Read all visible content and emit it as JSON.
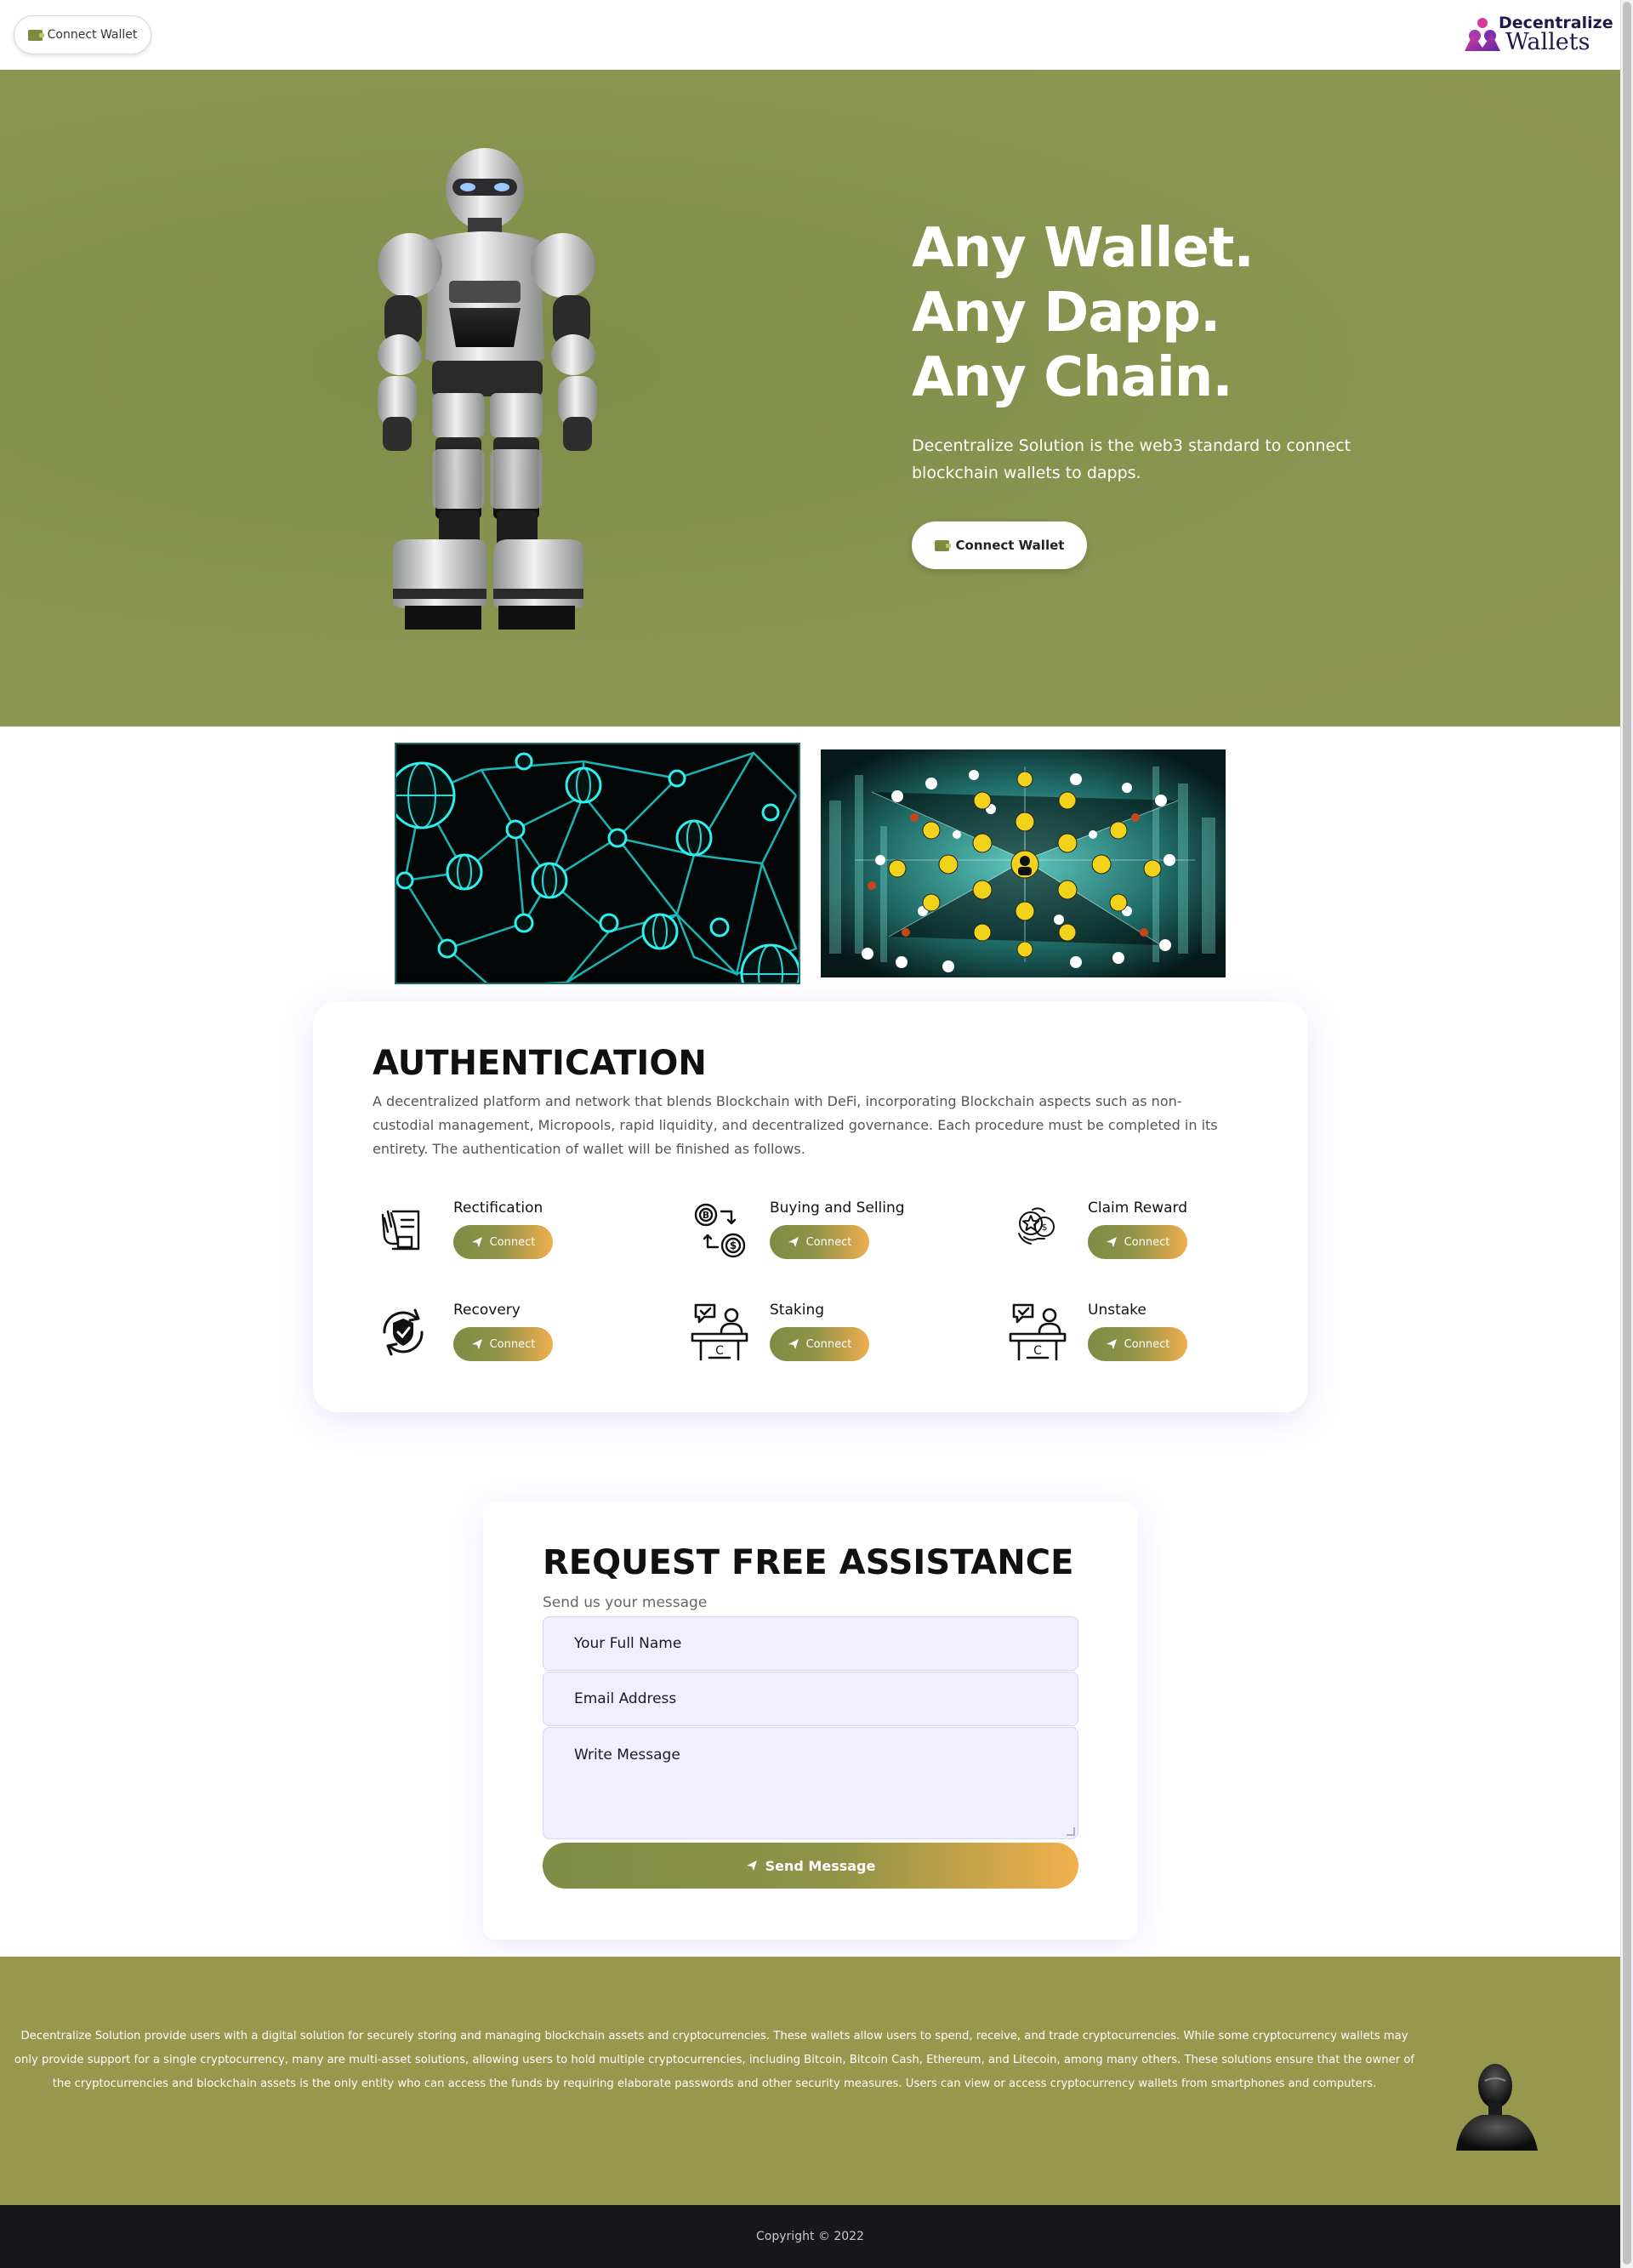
{
  "header": {
    "connect_wallet_label": "Connect Wallet",
    "logo_line1": "Decentralize",
    "logo_line2": "Wallets"
  },
  "hero": {
    "title_line1": "Any Wallet.",
    "title_line2": "Any Dapp.",
    "title_line3": "Any Chain.",
    "description": "Decentralize Solution is the web3 standard to connect blockchain wallets to dapps.",
    "button_label": "Connect Wallet"
  },
  "authentication": {
    "title": "AUTHENTICATION",
    "description": "A decentralized platform and network that blends Blockchain with DeFi, incorporating Blockchain aspects such as non-custodial management, Micropools, rapid liquidity, and decentralized governance. Each procedure must be completed in its entirety. The authentication of wallet will be finished as follows.",
    "features": [
      {
        "label": "Rectification",
        "button": "Connect",
        "icon": "document-hand-icon"
      },
      {
        "label": "Buying and Selling",
        "button": "Connect",
        "icon": "crypto-exchange-icon"
      },
      {
        "label": "Claim Reward",
        "button": "Connect",
        "icon": "reward-coins-icon"
      },
      {
        "label": "Recovery",
        "button": "Connect",
        "icon": "shield-recovery-icon"
      },
      {
        "label": "Staking",
        "button": "Connect",
        "icon": "staking-desk-icon"
      },
      {
        "label": "Unstake",
        "button": "Connect",
        "icon": "unstake-desk-icon"
      }
    ]
  },
  "assistance": {
    "title": "REQUEST FREE ASSISTANCE",
    "subtitle": "Send us your message",
    "name_placeholder": "Your Full Name",
    "email_placeholder": "Email Address",
    "message_placeholder": "Write Message",
    "send_label": "Send Message"
  },
  "footer": {
    "text": "Decentralize Solution provide users with a digital solution for securely storing and managing blockchain assets and cryptocurrencies. These wallets allow users to spend, receive, and trade cryptocurrencies. While some cryptocurrency wallets may only provide support for a single cryptocurrency, many are multi-asset solutions, allowing users to hold multiple cryptocurrencies, including Bitcoin, Bitcoin Cash, Ethereum, and Litecoin, among many others. These solutions ensure that the owner of the cryptocurrencies and blockchain assets is the only entity who can access the funds by requiring elaborate passwords and other security measures. Users can view or access cryptocurrency wallets from smartphones and computers.",
    "copyright": "Copyright © 2022"
  },
  "colors": {
    "accent_olive": "#8a9650",
    "accent_orange": "#efae4d",
    "form_field_bg": "#f1efff",
    "footer_bg": "#97974d",
    "copyright_bg": "#17171c"
  }
}
